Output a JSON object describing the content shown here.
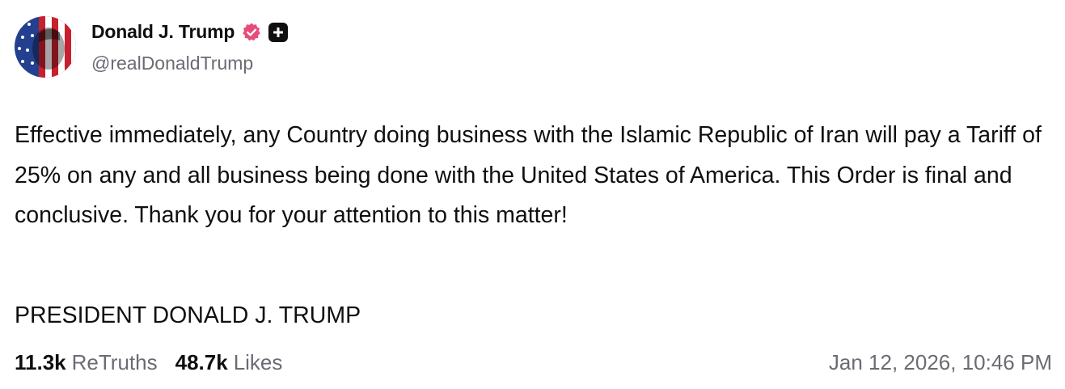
{
  "author": {
    "display_name": "Donald J. Trump",
    "handle": "@realDonaldTrump",
    "avatar_icon": "avatar-flag-portrait",
    "verified_icon": "verified-badge-icon",
    "plus_icon": "plus-badge-icon"
  },
  "post": {
    "text": "Effective immediately, any Country doing business with the Islamic Republic of Iran will pay a Tariff of 25% on any and all business being done with the United States of America. This Order is final and conclusive. Thank you for your attention to this matter!",
    "signature": "PRESIDENT DONALD J. TRUMP"
  },
  "stats": {
    "retruths_count": "11.3k",
    "retruths_label": "ReTruths",
    "likes_count": "48.7k",
    "likes_label": "Likes"
  },
  "timestamp": "Jan 12, 2026, 10:46 PM",
  "colors": {
    "text_primary": "#0f0f10",
    "text_secondary": "#6b6b74",
    "verified_badge": "#e74c78",
    "background": "#ffffff"
  }
}
